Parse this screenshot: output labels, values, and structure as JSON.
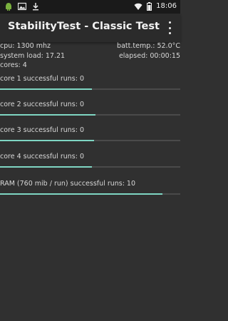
{
  "status_bar": {
    "time": "18:06",
    "left_icons": [
      "android-icon",
      "image-icon",
      "download-icon"
    ],
    "right_icons": [
      "wifi-icon",
      "battery-icon"
    ]
  },
  "app_bar": {
    "title": "StabilityTest - Classic Test",
    "menu_icon": "overflow-menu-icon"
  },
  "info": {
    "cpu": "cpu: 1300 mhz",
    "batt_temp": "batt.temp.: 52.0°C",
    "system_load": "system load: 17.21",
    "elapsed": "elapsed: 00:00:15",
    "cores": "cores: 4"
  },
  "runs": [
    {
      "label": "core 1 successful runs: 0",
      "progress": 0.51
    },
    {
      "label": "core 2 successful runs: 0",
      "progress": 0.53
    },
    {
      "label": "core 3 successful runs: 0",
      "progress": 0.52
    },
    {
      "label": "core 4 successful runs: 0",
      "progress": 0.51
    },
    {
      "label": "RAM (760 mib / run) successful runs: 10",
      "progress": 0.9
    }
  ],
  "colors": {
    "progress_fill": "#7fd6c3",
    "progress_track": "#4a4a4a",
    "background": "#303030"
  }
}
